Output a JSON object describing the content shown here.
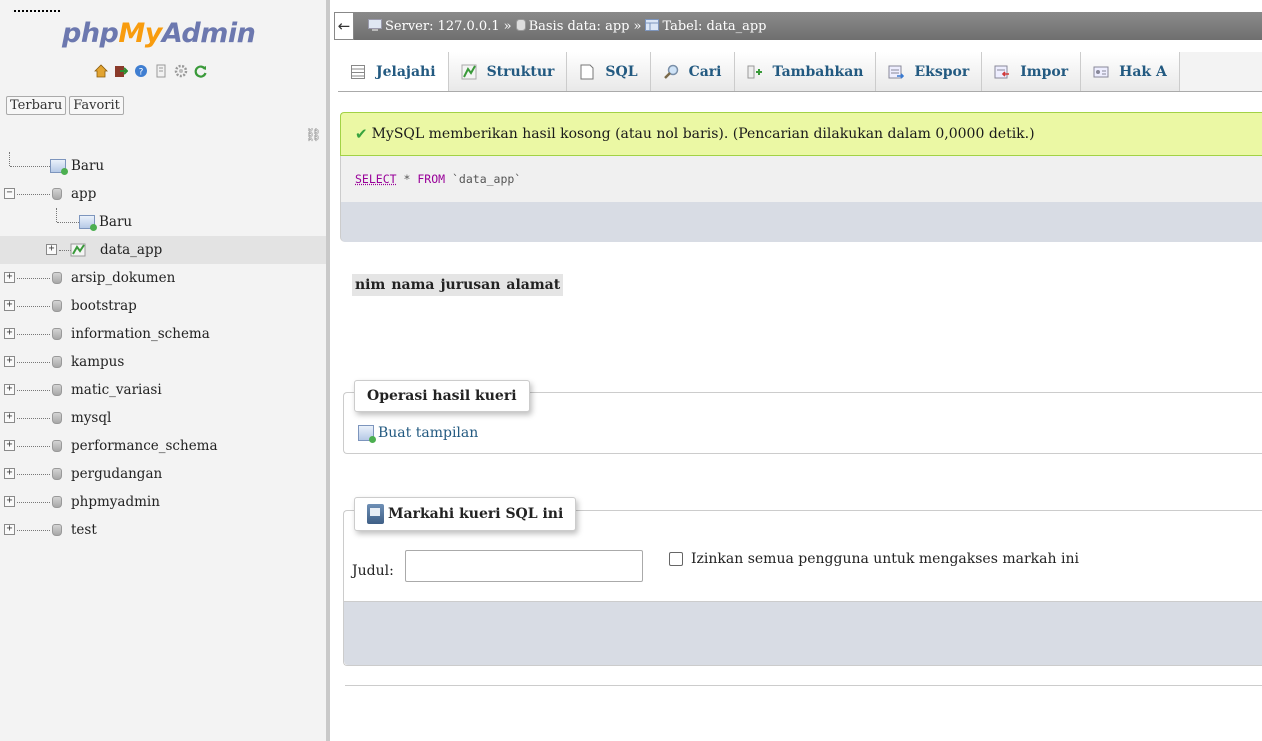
{
  "sidebar": {
    "logo": {
      "php": "php",
      "my": "My",
      "admin": "Admin"
    },
    "quick_icons": [
      "home-icon",
      "exit-icon",
      "help-icon",
      "docs-icon",
      "settings-icon",
      "reload-icon"
    ],
    "nav_tabs": [
      "Terbaru",
      "Favorit"
    ],
    "link_icon": "link-icon",
    "tree": [
      {
        "label": "Baru",
        "level": 0,
        "type": "new"
      },
      {
        "label": "app",
        "level": 0,
        "type": "db",
        "expanded": true
      },
      {
        "label": "Baru",
        "level": 1,
        "type": "new"
      },
      {
        "label": "data_app",
        "level": 1,
        "type": "table",
        "highlight": true
      },
      {
        "label": "arsip_dokumen",
        "level": 0,
        "type": "db"
      },
      {
        "label": "bootstrap",
        "level": 0,
        "type": "db"
      },
      {
        "label": "information_schema",
        "level": 0,
        "type": "db"
      },
      {
        "label": "kampus",
        "level": 0,
        "type": "db"
      },
      {
        "label": "matic_variasi",
        "level": 0,
        "type": "db"
      },
      {
        "label": "mysql",
        "level": 0,
        "type": "db"
      },
      {
        "label": "performance_schema",
        "level": 0,
        "type": "db"
      },
      {
        "label": "pergudangan",
        "level": 0,
        "type": "db"
      },
      {
        "label": "phpmyadmin",
        "level": 0,
        "type": "db"
      },
      {
        "label": "test",
        "level": 0,
        "type": "db"
      }
    ]
  },
  "topbar": {
    "back": "←",
    "server": "Server: 127.0.0.1",
    "sep1": "»",
    "database": "Basis data: app",
    "sep2": "»",
    "table": "Tabel: data_app"
  },
  "menu": [
    {
      "label": "Jelajahi",
      "icon": "browse-icon",
      "active": true
    },
    {
      "label": "Struktur",
      "icon": "structure-icon"
    },
    {
      "label": "SQL",
      "icon": "sql-icon"
    },
    {
      "label": "Cari",
      "icon": "search-icon"
    },
    {
      "label": "Tambahkan",
      "icon": "insert-icon"
    },
    {
      "label": "Ekspor",
      "icon": "export-icon"
    },
    {
      "label": "Impor",
      "icon": "import-icon"
    },
    {
      "label": "Hak A",
      "icon": "privileges-icon"
    }
  ],
  "message": {
    "text": "MySQL memberikan hasil kosong (atau nol baris). (Pencarian dilakukan dalam 0,0000 detik.)"
  },
  "sql": {
    "select": "SELECT",
    "star": "*",
    "from": "FROM",
    "table": "`data_app`"
  },
  "columns": [
    "nim",
    "nama",
    "jurusan",
    "alamat"
  ],
  "query_ops": {
    "legend": "Operasi hasil kueri",
    "create_view": "Buat tampilan"
  },
  "bookmark": {
    "legend": "Markahi kueri SQL ini",
    "label": "Judul:",
    "value": "",
    "placeholder": "",
    "checkbox_label": "Izinkan semua pengguna untuk mengakses markah ini"
  }
}
